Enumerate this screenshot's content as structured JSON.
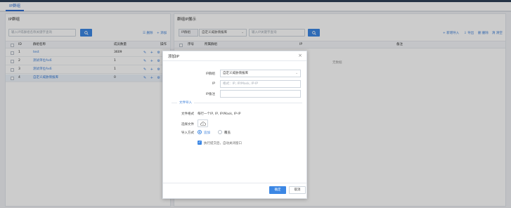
{
  "tabs": {
    "active": "IP群组"
  },
  "left_panel": {
    "title": "IP群组",
    "search_placeholder": "输入IP或群组名称关键字查询",
    "delete_label": "删除",
    "add_label": "添加",
    "columns": [
      "ID",
      "群组名称",
      "成员数量",
      "操作"
    ],
    "rows": [
      {
        "id": "1",
        "name": "test",
        "count": "3609",
        "name_color": "#3c7fd8"
      },
      {
        "id": "2",
        "name": "测试单位Ax6",
        "count": "1",
        "name_color": "#3c7fd8"
      },
      {
        "id": "3",
        "name": "测试单位Ax6",
        "count": "1",
        "name_color": "#3c7fd8"
      },
      {
        "id": "4",
        "name": "自定义威胁情报库",
        "count": "0",
        "name_color": "#3c7fd8"
      }
    ],
    "action_icons": "✎ + ⚙ ✕"
  },
  "right_panel": {
    "title": "群组IP展示",
    "group_label": "IP群组",
    "group_value": "自定义威胁情报库",
    "search_placeholder": "输入IP关键字查询",
    "actions": [
      "+ 新增导入",
      "⇩ 导出",
      "删 删除",
      "清 清空"
    ],
    "columns": [
      "序号",
      "所属群组",
      "IP",
      "备注"
    ],
    "empty_text": "无数据"
  },
  "modal": {
    "title": "添加IP",
    "close_glyph": "×",
    "fields": {
      "group_label": "IP群组",
      "group_value": "自定义威胁情报库",
      "ip_label": "IP",
      "ip_placeholder": "格式：IP, IP/Mask, IP-IP",
      "remark_label": "IP备注",
      "remark_value": ""
    },
    "section_title": "文件导入",
    "file_format_label": "文件格式",
    "file_format_value": "每行一个IP, IP, IP/Mask, IP-IP",
    "choose_file_label": "选择文件",
    "import_mode_label": "导入方式",
    "import_modes": [
      "追加",
      "覆盖"
    ],
    "selected_mode": "追加",
    "auto_close_label": "执行提交后，自动关闭窗口",
    "auto_close_checked": true,
    "confirm_label": "确定",
    "cancel_label": "取消"
  },
  "colors": {
    "accent": "#3c87e4",
    "link": "#3c7fd8"
  }
}
